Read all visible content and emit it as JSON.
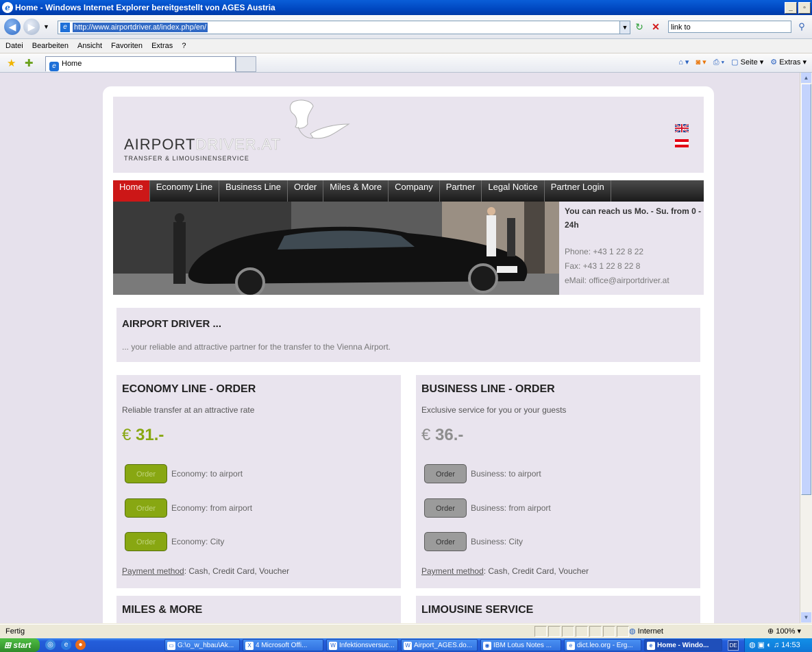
{
  "window": {
    "title": "Home - Windows Internet Explorer bereitgestellt von AGES Austria",
    "minimize": "_",
    "maximize": "▫"
  },
  "address": {
    "url": "http://www.airportdriver.at/index.php/en/",
    "search_value": "link to"
  },
  "menu": [
    "Datei",
    "Bearbeiten",
    "Ansicht",
    "Favoriten",
    "Extras",
    "?"
  ],
  "tab": {
    "label": "Home"
  },
  "commands": {
    "page": "Seite",
    "extras": "Extras"
  },
  "site": {
    "logo_dark": "AIRPORT",
    "logo_light": "DRIVER.AT",
    "tagline": "TRANSFER & LIMOUSINENSERVICE",
    "nav": [
      "Home",
      "Economy Line",
      "Business Line",
      "Order",
      "Miles & More",
      "Company",
      "Partner",
      "Legal Notice",
      "Partner Login"
    ],
    "contact": {
      "reach": "You can reach us Mo. - Su. from 0 - 24h",
      "phone": "Phone: +43 1 22 8 22",
      "fax": "Fax: +43 1 22 8 22 8",
      "email": "eMail: office@airportdriver.at"
    },
    "intro": {
      "title": "AIRPORT DRIVER ...",
      "text": "... your reliable and attractive partner for the transfer to the Vienna Airport."
    },
    "economy": {
      "title": "ECONOMY LINE - ORDER",
      "subtitle": "Reliable transfer at an attractive rate",
      "currency": "€",
      "price": "31.-",
      "button": "Order",
      "options": [
        "Economy: to airport",
        "Economy: from airport",
        "Economy: City"
      ],
      "payment_label": "Payment method",
      "payment_value": ": Cash, Credit Card, Voucher"
    },
    "business": {
      "title": "BUSINESS LINE - ORDER",
      "subtitle": "Exclusive service for you or your guests",
      "currency": "€",
      "price": "36.-",
      "button": "Order",
      "options": [
        "Business: to airport",
        "Business: from airport",
        "Business: City"
      ],
      "payment_label": "Payment method",
      "payment_value": ": Cash, Credit Card, Voucher"
    },
    "miles_title": "MILES & MORE",
    "limousine_title": "LIMOUSINE SERVICE"
  },
  "status": {
    "text": "Fertig",
    "zone": "Internet",
    "zoom": "100%"
  },
  "taskbar": {
    "start": "start",
    "tasks": [
      "G:\\o_w_hbau\\Ak...",
      "4 Microsoft Offi...",
      "Infektionsversuc...",
      "Airport_AGES.do...",
      "IBM Lotus Notes ...",
      "dict.leo.org - Erg...",
      "Home - Windo..."
    ],
    "lang": "DE",
    "clock": "14:53"
  },
  "colors": {
    "economy_price": "#88a712",
    "business_price": "#8e8e8e",
    "nav_active": "#cc1717"
  }
}
